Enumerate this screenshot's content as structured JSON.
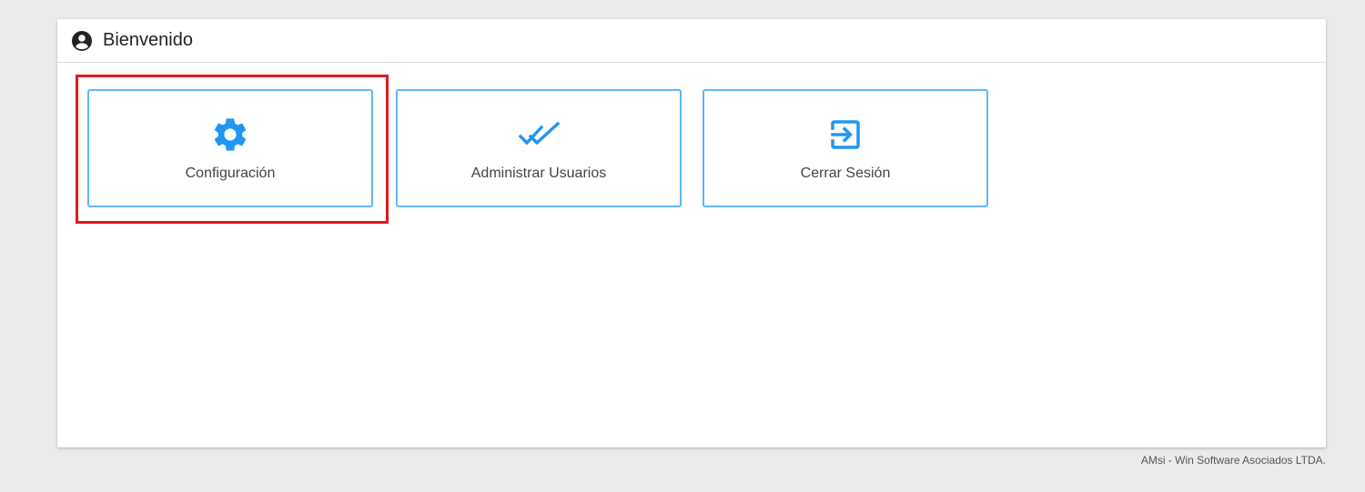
{
  "header": {
    "title": "Bienvenido",
    "icon": "account-circle-icon"
  },
  "tiles": [
    {
      "label": "Configuración",
      "icon": "gear-icon",
      "highlighted": true
    },
    {
      "label": "Administrar Usuarios",
      "icon": "double-check-icon",
      "highlighted": false
    },
    {
      "label": "Cerrar Sesión",
      "icon": "exit-to-app-icon",
      "highlighted": false
    }
  ],
  "footer": {
    "text": "AMsi - Win Software Asociados LTDA."
  },
  "colors": {
    "accent": "#2196f3",
    "tile_border": "#64b5f6",
    "highlight": "#e01b1b",
    "background": "#ebebeb"
  }
}
